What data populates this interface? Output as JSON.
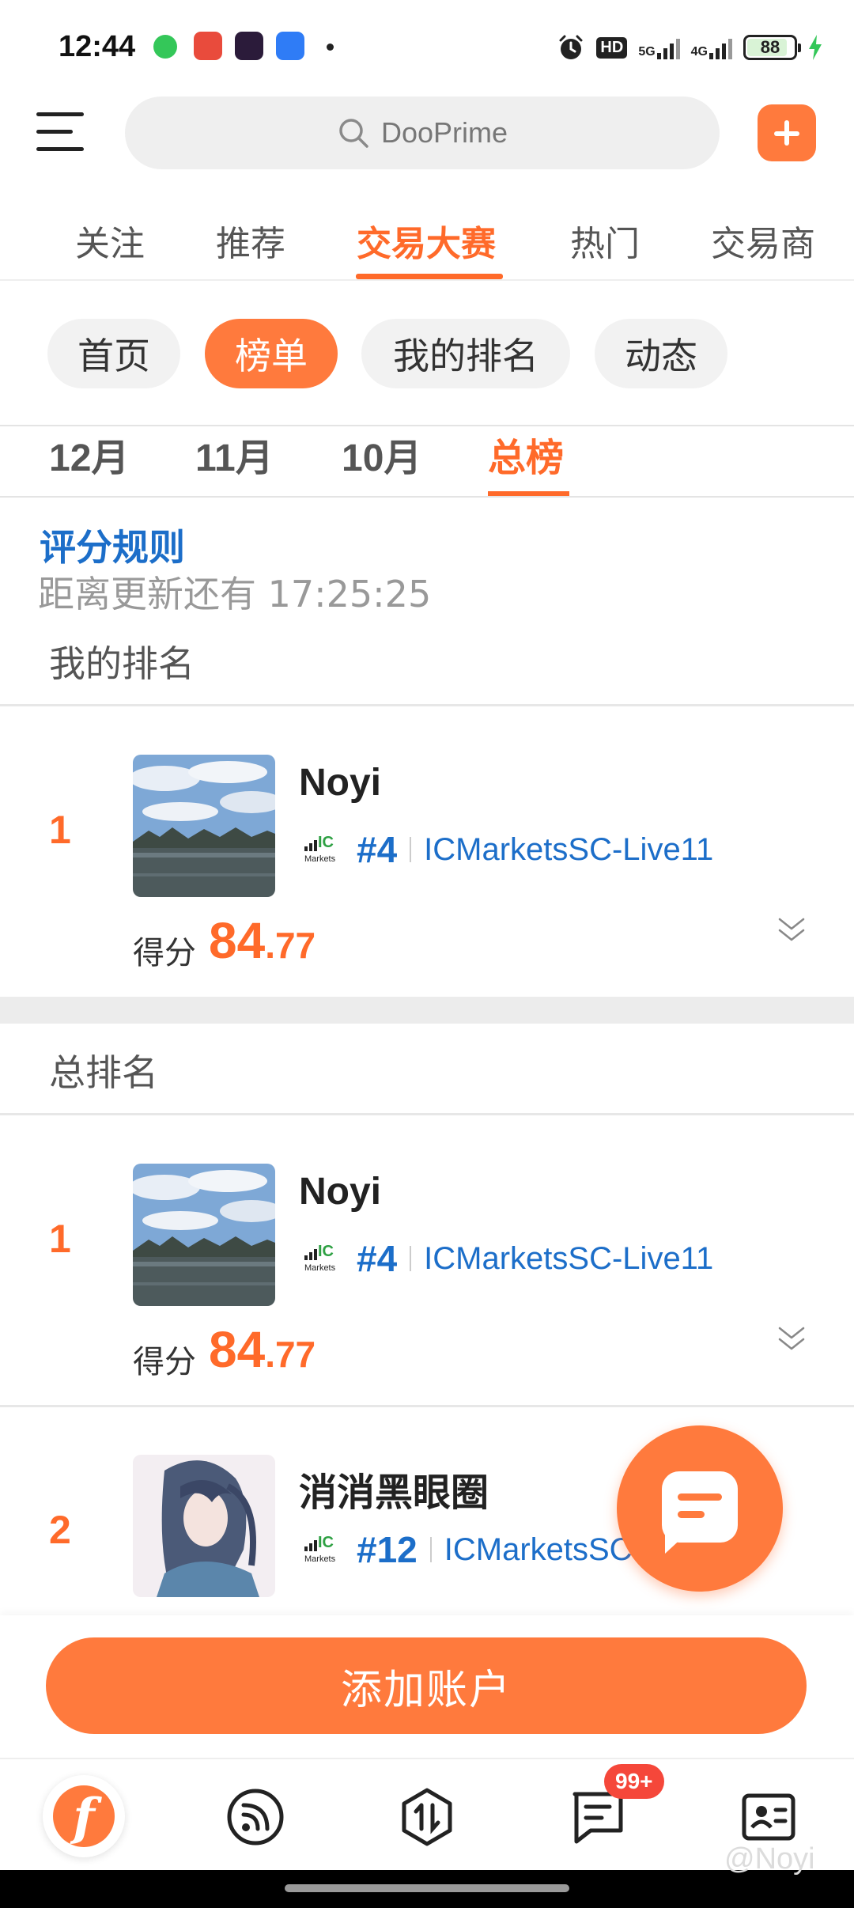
{
  "status_bar": {
    "time": "12:44",
    "network": "5G",
    "network2": "4G",
    "hd": "HD",
    "battery": "88"
  },
  "header": {
    "search_placeholder": "DooPrime"
  },
  "top_tabs": [
    "关注",
    "推荐",
    "交易大赛",
    "热门",
    "交易商"
  ],
  "sub_pills": [
    "首页",
    "榜单",
    "我的排名",
    "动态"
  ],
  "months": [
    "12月",
    "11月",
    "10月",
    "总榜"
  ],
  "info": {
    "rules_link": "评分规则",
    "countdown": "距离更新还有 17:25:25"
  },
  "my_rank": {
    "section_label": "我的排名",
    "entry": {
      "rank": "1",
      "name": "Noyi",
      "broker_rank": "#4",
      "server": "ICMarketsSC-Live11",
      "score_label": "得分",
      "score_int": "84",
      "score_dec": ".77"
    }
  },
  "overall": {
    "section_label": "总排名",
    "entries": [
      {
        "rank": "1",
        "name": "Noyi",
        "broker_rank": "#4",
        "server": "ICMarketsSC-Live11",
        "score_label": "得分",
        "score_int": "84",
        "score_dec": ".77"
      },
      {
        "rank": "2",
        "name": "消消黑眼圈",
        "broker_rank": "#12",
        "server": "ICMarketsSC"
      }
    ]
  },
  "broker_logo": {
    "ic": "IC",
    "markets": "Markets"
  },
  "add_account_label": "添加账户",
  "bottom_nav": {
    "badge": "99+"
  },
  "watermark": "@Noyi",
  "colors": {
    "accent": "#ff6a2a",
    "link_blue": "#1c6ec9",
    "badge_red": "#f5473a"
  }
}
